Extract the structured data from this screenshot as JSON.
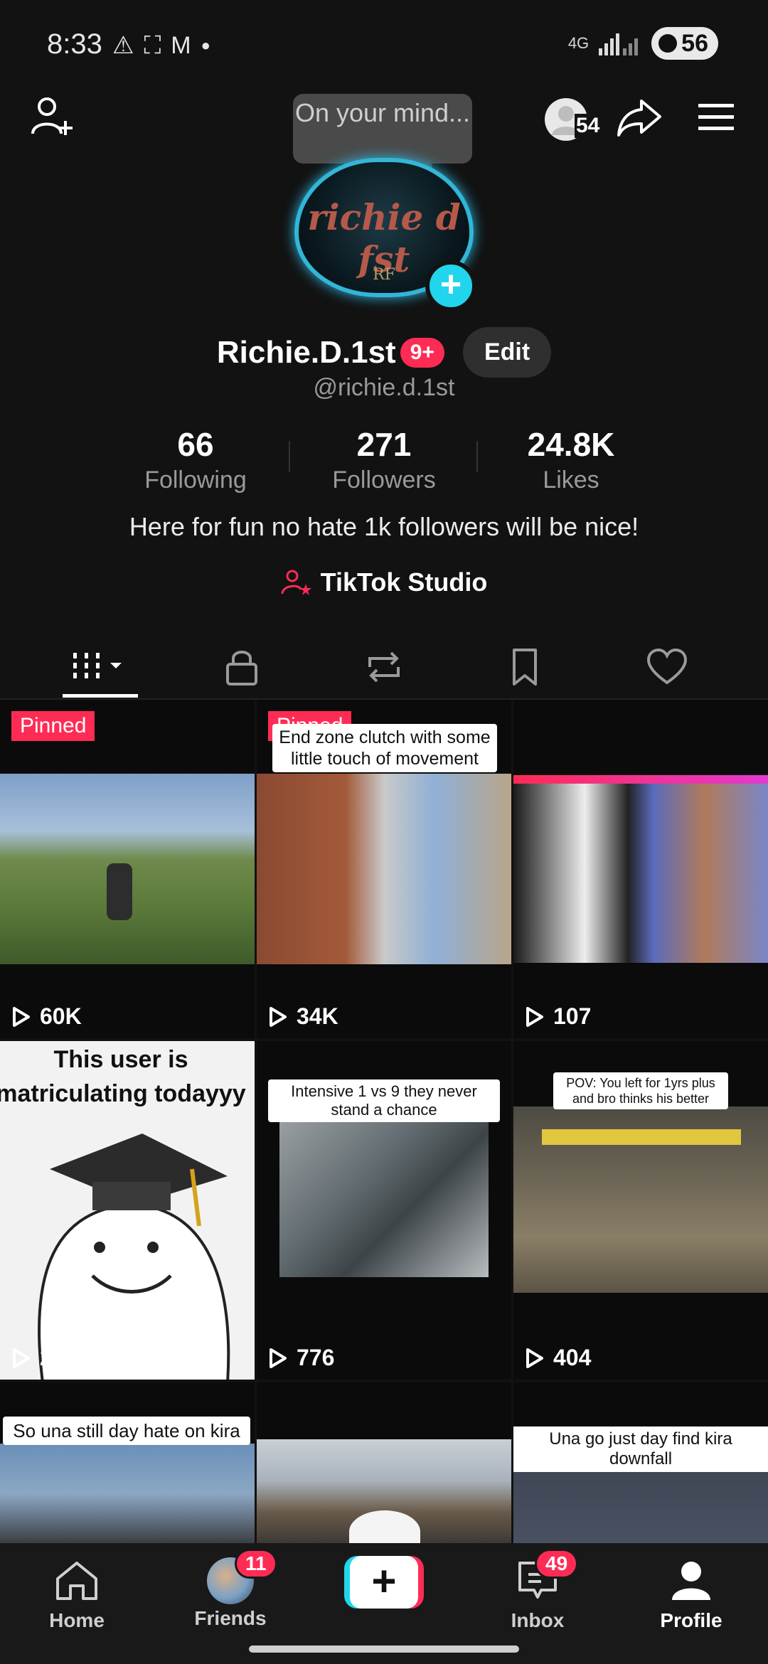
{
  "status_bar": {
    "time": "8:33",
    "network": "4G",
    "battery": "56"
  },
  "header": {
    "mind_bubble": "On your mind...",
    "friends_count": "54"
  },
  "profile": {
    "avatar_text": "richie d fst",
    "avatar_mark": "RF",
    "name": "Richie.D.1st",
    "notification_badge": "9+",
    "edit_label": "Edit",
    "handle": "@richie.d.1st",
    "stats": [
      {
        "value": "66",
        "label": "Following"
      },
      {
        "value": "271",
        "label": "Followers"
      },
      {
        "value": "24.8K",
        "label": "Likes"
      }
    ],
    "bio": "Here for fun no hate 1k followers will be nice!",
    "studio_label": "TikTok Studio"
  },
  "tabs": [
    "videos",
    "private",
    "reposts",
    "favorites",
    "liked"
  ],
  "videos": [
    {
      "pinned": "Pinned",
      "views": "60K",
      "caption": ""
    },
    {
      "pinned": "Pinned",
      "views": "34K",
      "caption": "End zone clutch with some little touch of movement"
    },
    {
      "pinned": "",
      "views": "107",
      "caption": ""
    },
    {
      "pinned": "",
      "views": "278",
      "caption": "This user is matriculating todayyy"
    },
    {
      "pinned": "",
      "views": "776",
      "caption": "Intensive 1 vs 9 they never stand a chance"
    },
    {
      "pinned": "",
      "views": "404",
      "caption": "POV: You left for 1yrs plus and bro thinks his better"
    },
    {
      "pinned": "",
      "views": "",
      "caption": "So una still day hate on kira"
    },
    {
      "pinned": "",
      "views": "",
      "caption": ""
    },
    {
      "pinned": "",
      "views": "",
      "caption": "Una go just day find kira downfall"
    }
  ],
  "bottom_nav": {
    "home": "Home",
    "friends": "Friends",
    "friends_badge": "11",
    "create": "+",
    "inbox": "Inbox",
    "inbox_badge": "49",
    "profile": "Profile"
  },
  "colors": {
    "accent_red": "#fe2c55",
    "accent_cyan": "#20d5ec",
    "background": "#121212"
  }
}
